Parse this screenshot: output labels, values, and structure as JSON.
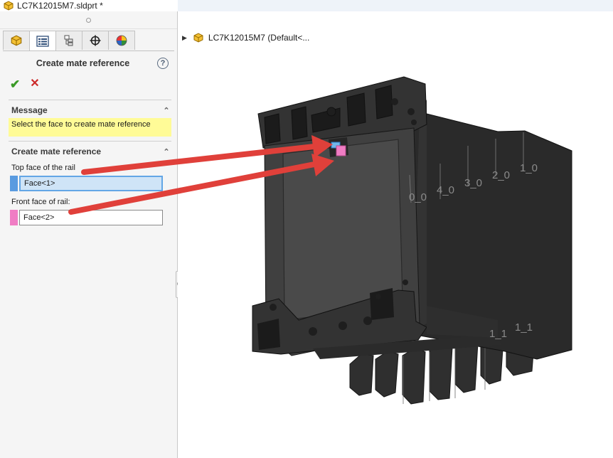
{
  "window": {
    "title": "LC7K12015M7.sldprt *"
  },
  "panel": {
    "tabs": [
      "feature-manager",
      "property-manager",
      "configuration-manager",
      "dimxpert-manager",
      "display-manager"
    ],
    "title": "Create mate reference",
    "help": "?",
    "ok_symbol": "✔",
    "cancel_symbol": "✕",
    "message_group": {
      "heading": "Message",
      "text": "Select the face to create mate reference"
    },
    "mate_group": {
      "heading": "Create mate reference",
      "fields": [
        {
          "label": "Top face of the rail",
          "value": "Face<1>",
          "swatch": "#5a9be0",
          "active": true
        },
        {
          "label": "Front face of rail:",
          "value": "Face<2>",
          "swatch": "#f07dc4",
          "active": false
        }
      ]
    }
  },
  "viewport": {
    "tree_node": {
      "label": "LC7K12015M7  (Default<..."
    },
    "model_labels": [
      "0_0",
      "4_0",
      "3_0",
      "2_0",
      "1_0",
      "1_1",
      "1_1"
    ],
    "colors": {
      "body": "#3e3e3e",
      "body_dark": "#262626",
      "arrow": "#e0403a",
      "face1": "#6fb7ea",
      "face2": "#f07dc4"
    }
  }
}
